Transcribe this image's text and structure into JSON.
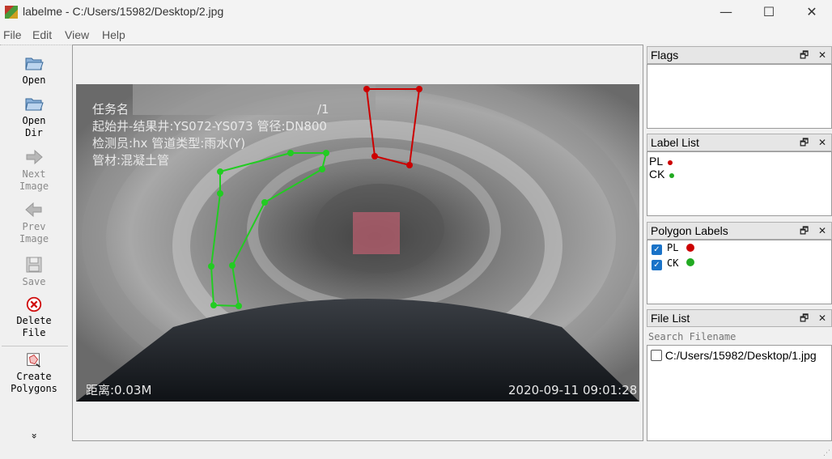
{
  "window": {
    "title": "labelme - C:/Users/15982/Desktop/2.jpg",
    "minimize_glyph": "—",
    "maximize_glyph": "☐",
    "close_glyph": "✕"
  },
  "menu": [
    "File",
    "Edit",
    "View",
    "Help"
  ],
  "toolbar": {
    "open": "Open",
    "open_dir_1": "Open",
    "open_dir_2": "Dir",
    "next_1": "Next",
    "next_2": "Image",
    "prev_1": "Prev",
    "prev_2": "Image",
    "save": "Save",
    "delete_1": "Delete",
    "delete_2": "File",
    "create_1": "Create",
    "create_2": "Polygons",
    "more": "»"
  },
  "photo_overlay": {
    "line1": "任务名",
    "line1_suffix": "/1",
    "line2": "起始井-结果井:YS072-YS073  管径:DN800",
    "line3": "检测员:hx  管道类型:雨水(Y)",
    "line4": "管材:混凝土管",
    "distance": "距离:0.03M",
    "timestamp": "2020-09-11  09:01:28"
  },
  "docks": {
    "flags_title": "Flags",
    "label_list_title": "Label List",
    "polygon_labels_title": "Polygon Labels",
    "file_list_title": "File List",
    "float_glyph": "🗗",
    "close_glyph": "✕"
  },
  "label_list": [
    {
      "name": "PL",
      "color": "#cc0000"
    },
    {
      "name": "CK",
      "color": "#22aa22"
    }
  ],
  "polygon_labels": [
    {
      "name": "PL",
      "color": "#cc0000",
      "checked": true
    },
    {
      "name": "CK",
      "color": "#22aa22",
      "checked": true
    }
  ],
  "file_list": {
    "search_placeholder": "Search Filename",
    "files": [
      {
        "path": "C:/Users/15982/Desktop/1.jpg",
        "checked": false
      }
    ]
  },
  "colors": {
    "pl": "#cc0000",
    "ck": "#22cc22"
  }
}
